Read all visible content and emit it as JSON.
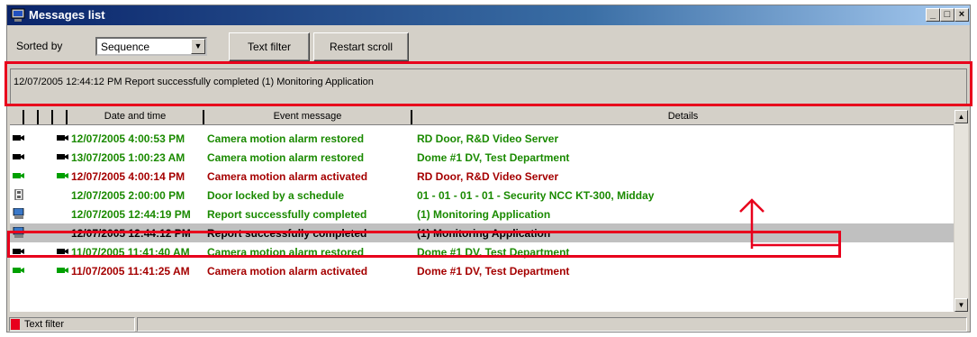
{
  "window": {
    "title": "Messages list",
    "controls": [
      "_",
      "□",
      "×"
    ]
  },
  "toolbar": {
    "sorted_by_label": "Sorted by",
    "sort_value": "Sequence",
    "text_filter_label": "Text filter",
    "restart_scroll_label": "Restart scroll"
  },
  "message_bar": {
    "text": "12/07/2005 12:44:12 PM  Report successfully completed  (1)  Monitoring Application"
  },
  "columns": {
    "date": "Date and time",
    "event": "Event message",
    "details": "Details"
  },
  "rows": [
    {
      "icon": "camera-icon",
      "icon_color": "#000000",
      "type_icon": "camera-icon",
      "date": "12/07/2005 4:00:53 PM",
      "event": "Camera motion alarm restored",
      "details": "RD Door, R&D Video Server",
      "color": "green"
    },
    {
      "icon": "camera-icon",
      "icon_color": "#000000",
      "type_icon": "camera-icon",
      "date": "13/07/2005 1:00:23 AM",
      "event": "Camera motion alarm restored",
      "details": "Dome #1 DV, Test Department",
      "color": "green"
    },
    {
      "icon": "camera-icon",
      "icon_color": "#00a000",
      "type_icon": "camera-icon",
      "date": "12/07/2005 4:00:14 PM",
      "event": "Camera motion alarm activated",
      "details": "RD Door, R&D Video Server",
      "color": "red"
    },
    {
      "icon": "door-icon",
      "icon_color": "#606060",
      "type_icon": "",
      "date": "12/07/2005 2:00:00 PM",
      "event": "Door locked by a schedule",
      "details": "01 - 01 - 01 - 01 - Security NCC KT-300, Midday",
      "color": "green"
    },
    {
      "icon": "computer-icon",
      "icon_color": "#3a78c8",
      "type_icon": "",
      "date": "12/07/2005 12:44:19 PM",
      "event": "Report successfully completed",
      "details": "(1)  Monitoring Application",
      "color": "green"
    },
    {
      "icon": "computer-icon",
      "icon_color": "#3a78c8",
      "type_icon": "",
      "date": "12/07/2005 12:44:12 PM",
      "event": "Report successfully completed",
      "details": "(1)  Monitoring Application",
      "color": "black",
      "selected": true
    },
    {
      "icon": "camera-icon",
      "icon_color": "#000000",
      "type_icon": "camera-icon",
      "date": "11/07/2005 11:41:40 AM",
      "event": "Camera motion alarm restored",
      "details": "Dome #1 DV, Test Department",
      "color": "green"
    },
    {
      "icon": "camera-icon",
      "icon_color": "#00a000",
      "type_icon": "camera-icon",
      "date": "11/07/2005 11:41:25 AM",
      "event": "Camera motion alarm activated",
      "details": "Dome #1 DV, Test Department",
      "color": "red"
    }
  ],
  "status": {
    "filter_label": "Text filter",
    "filter_indicator_color": "#e8001c"
  },
  "annotation": {
    "highlight_color": "#e8001c"
  }
}
